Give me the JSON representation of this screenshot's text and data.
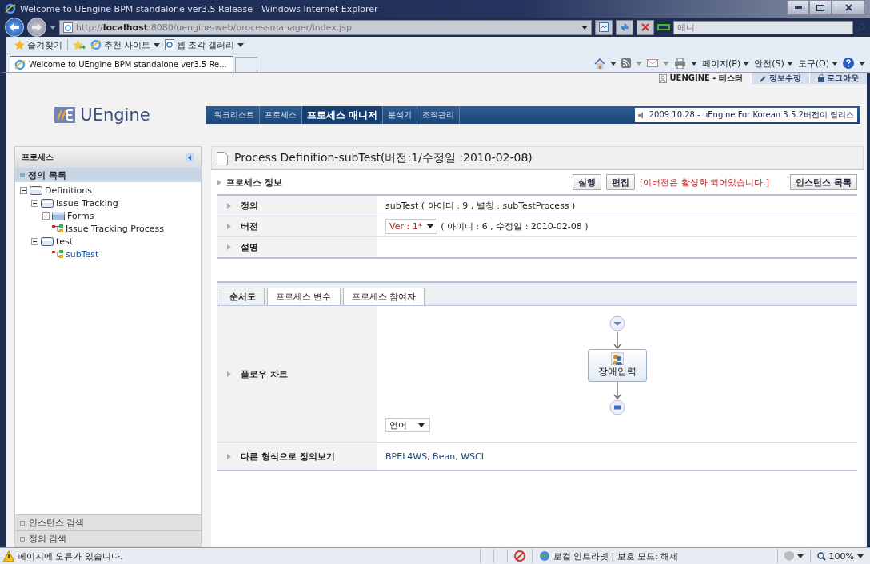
{
  "window": {
    "title": "Welcome to UEngine BPM standalone ver3.5 Release - Windows Internet Explorer"
  },
  "address_bar": {
    "url": "http://**localhost**:8080/uengine-web/processmanager/index.jsp"
  },
  "search": {
    "placeholder": "애니"
  },
  "favorites_bar": {
    "favorites": "즐겨찾기",
    "links": [
      {
        "label": "추천 사이트"
      },
      {
        "label": "웹 조각 갤러리"
      }
    ]
  },
  "browser_tabs": [
    {
      "label": "Welcome to UEngine BPM standalone ver3.5 Re...",
      "selected": true
    }
  ],
  "command_bar": [
    "페이지(P)",
    "안전(S)",
    "도구(O)"
  ],
  "user_bar": {
    "user": "UENGINE - 테스터",
    "edit": "정보수정",
    "logout": "로그아웃"
  },
  "logo": {
    "text": "UEngine"
  },
  "nav": [
    {
      "label": "워크리스트",
      "selected": false
    },
    {
      "label": "프로세스",
      "selected": false
    },
    {
      "label": "프로세스 매니저",
      "selected": true
    },
    {
      "label": "분석기",
      "selected": false
    },
    {
      "label": "조직관리",
      "selected": false
    }
  ],
  "ticker": "2009.10.28 - uEngine For Korean 3.5.2버전이 릴리스",
  "sidebar": {
    "title": "프로세스",
    "section": "정의 목록",
    "tree": [
      {
        "label": "Definitions",
        "kind": "folder",
        "expanded": true,
        "selected": false,
        "children": [
          {
            "label": "Issue Tracking",
            "kind": "folder",
            "expanded": true,
            "selected": false,
            "children": [
              {
                "label": "Forms",
                "kind": "forms",
                "expanded": false,
                "selected": false
              },
              {
                "label": "Issue Tracking Process",
                "kind": "process",
                "selected": false
              }
            ]
          },
          {
            "label": "test",
            "kind": "folder",
            "expanded": true,
            "selected": false,
            "children": [
              {
                "label": "subTest",
                "kind": "process",
                "selected": true
              }
            ]
          }
        ]
      }
    ],
    "footer": [
      {
        "label": "인스턴스 검색"
      },
      {
        "label": "정의 검색"
      }
    ]
  },
  "main": {
    "title": "Process Definition-subTest(버전:1/수정일 :2010-02-08)",
    "section_title": "프로세스 정보",
    "buttons": [
      "실행",
      "편집"
    ],
    "notice": "[이버전은 활성화 되어있습니다.]",
    "instance_button": "인스턴스 목록",
    "info_rows": [
      {
        "label": "정의",
        "kind": "text",
        "value": "subTest ( 아이디 : 9 , 별칭 : subTestProcess )"
      },
      {
        "label": "버전",
        "kind": "version",
        "select": "Ver : 1*",
        "value": "( 아이디 : 6 , 수정일 : 2010-02-08 )"
      },
      {
        "label": "설명",
        "kind": "text"
      }
    ],
    "tabs": [
      {
        "label": "순서도",
        "selected": true
      },
      {
        "label": "프로세스 변수",
        "selected": false
      },
      {
        "label": "프로세스 참여자",
        "selected": false
      }
    ],
    "flow_chart": {
      "label": "플로우 차트",
      "activity": "장애입력",
      "language": "언어"
    },
    "other_formats": {
      "label": "다른 형식으로 정의보기",
      "value": "BPEL4WS, Bean, WSCI"
    }
  },
  "status_bar": {
    "message": "페이지에 오류가 있습니다.",
    "zone": "로컬 인트라넷 | 보호 모드: 해제",
    "zoom": "100%"
  }
}
